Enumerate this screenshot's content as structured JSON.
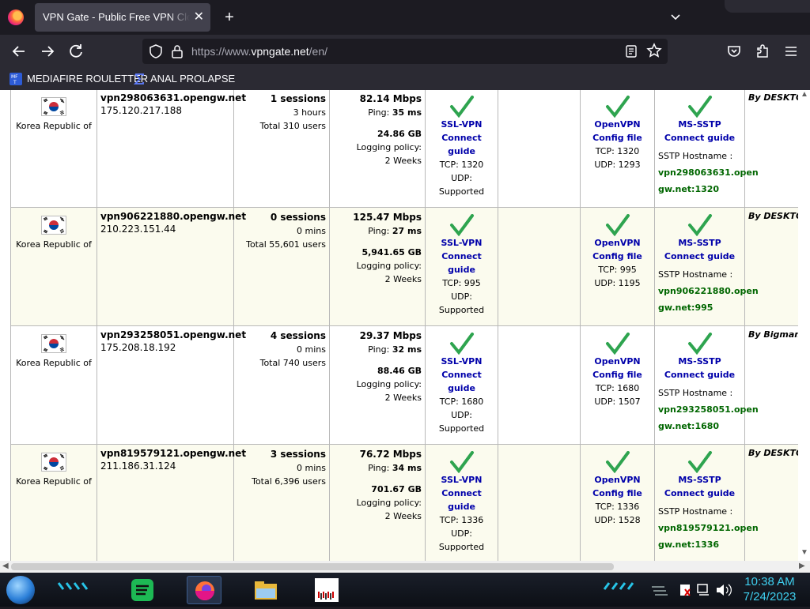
{
  "browser": {
    "tab_title": "VPN Gate - Public Free VPN Cloud by Univ of Tsukuba, Japan",
    "tab_close": "✕",
    "new_tab": "+",
    "tab_list": "⌄",
    "url_dim_prefix": "https://www.",
    "url_host": "vpngate.net",
    "url_dim_suffix": "/en/",
    "bookmarks": [
      {
        "label": "MEDIAFIRE ROULETTER",
        "icon": "mediafire-icon"
      },
      {
        "label": "ANAL PROLAPSE",
        "icon": "sigma-icon"
      }
    ]
  },
  "servers": [
    {
      "country": "Korea Republic of",
      "host": "vpn298063631.opengw.net",
      "ip": "175.120.217.188",
      "sessions": "1 sessions",
      "uptime": "3 hours",
      "total_users": "Total 310 users",
      "speed": "82.14 Mbps",
      "ping_label": "Ping:",
      "ping": "35 ms",
      "traffic": "24.86 GB",
      "logging_label": "Logging policy:",
      "logging": "2 Weeks",
      "ssl_title": "SSL-VPN",
      "ssl_guide": "Connect guide",
      "ssl_tcp": "TCP: 1320",
      "ssl_udp": "UDP: Supported",
      "ovpn_title": "OpenVPN",
      "ovpn_config": "Config file",
      "ovpn_tcp": "TCP: 1320",
      "ovpn_udp": "UDP: 1293",
      "sstp_title": "MS-SSTP",
      "sstp_guide": "Connect guide",
      "sstp_host_label": "SSTP Hostname :",
      "sstp_host_1": "vpn298063631.open",
      "sstp_host_2": "gw.net:1320",
      "operator": "By DESKTOP"
    },
    {
      "country": "Korea Republic of",
      "host": "vpn906221880.opengw.net",
      "ip": "210.223.151.44",
      "sessions": "0 sessions",
      "uptime": "0 mins",
      "total_users": "Total 55,601 users",
      "speed": "125.47 Mbps",
      "ping_label": "Ping:",
      "ping": "27 ms",
      "traffic": "5,941.65 GB",
      "logging_label": "Logging policy:",
      "logging": "2 Weeks",
      "ssl_title": "SSL-VPN",
      "ssl_guide": "Connect guide",
      "ssl_tcp": "TCP: 995",
      "ssl_udp": "UDP: Supported",
      "ovpn_title": "OpenVPN",
      "ovpn_config": "Config file",
      "ovpn_tcp": "TCP: 995",
      "ovpn_udp": "UDP: 1195",
      "sstp_title": "MS-SSTP",
      "sstp_guide": "Connect guide",
      "sstp_host_label": "SSTP Hostname :",
      "sstp_host_1": "vpn906221880.open",
      "sstp_host_2": "gw.net:995",
      "operator": "By DESKTOP"
    },
    {
      "country": "Korea Republic of",
      "host": "vpn293258051.opengw.net",
      "ip": "175.208.18.192",
      "sessions": "4 sessions",
      "uptime": "0 mins",
      "total_users": "Total 740 users",
      "speed": "29.37 Mbps",
      "ping_label": "Ping:",
      "ping": "32 ms",
      "traffic": "88.46 GB",
      "logging_label": "Logging policy:",
      "logging": "2 Weeks",
      "ssl_title": "SSL-VPN",
      "ssl_guide": "Connect guide",
      "ssl_tcp": "TCP: 1680",
      "ssl_udp": "UDP: Supported",
      "ovpn_title": "OpenVPN",
      "ovpn_config": "Config file",
      "ovpn_tcp": "TCP: 1680",
      "ovpn_udp": "UDP: 1507",
      "sstp_title": "MS-SSTP",
      "sstp_guide": "Connect guide",
      "sstp_host_label": "SSTP Hostname :",
      "sstp_host_1": "vpn293258051.open",
      "sstp_host_2": "gw.net:1680",
      "operator": "By Bigman's"
    },
    {
      "country": "Korea Republic of",
      "host": "vpn819579121.opengw.net",
      "ip": "211.186.31.124",
      "sessions": "3 sessions",
      "uptime": "0 mins",
      "total_users": "Total 6,396 users",
      "speed": "76.72 Mbps",
      "ping_label": "Ping:",
      "ping": "34 ms",
      "traffic": "701.67 GB",
      "logging_label": "Logging policy:",
      "logging": "2 Weeks",
      "ssl_title": "SSL-VPN",
      "ssl_guide": "Connect guide",
      "ssl_tcp": "TCP: 1336",
      "ssl_udp": "UDP: Supported",
      "ovpn_title": "OpenVPN",
      "ovpn_config": "Config file",
      "ovpn_tcp": "TCP: 1336",
      "ovpn_udp": "UDP: 1528",
      "sstp_title": "MS-SSTP",
      "sstp_guide": "Connect guide",
      "sstp_host_label": "SSTP Hostname :",
      "sstp_host_1": "vpn819579121.open",
      "sstp_host_2": "gw.net:1336",
      "operator": "By DESKTOP"
    }
  ],
  "taskbar": {
    "time": "10:38 AM",
    "date": "7/24/2023",
    "apps": [
      "spotify-icon",
      "firefox-icon",
      "file-explorer-icon",
      "notepad-icon"
    ]
  },
  "colors": {
    "link_blue": "#0000aa",
    "hostname_green": "#006600",
    "check_green": "#2ea44f",
    "row_alt": "#fbfbee",
    "clock": "#3fd0f0"
  }
}
